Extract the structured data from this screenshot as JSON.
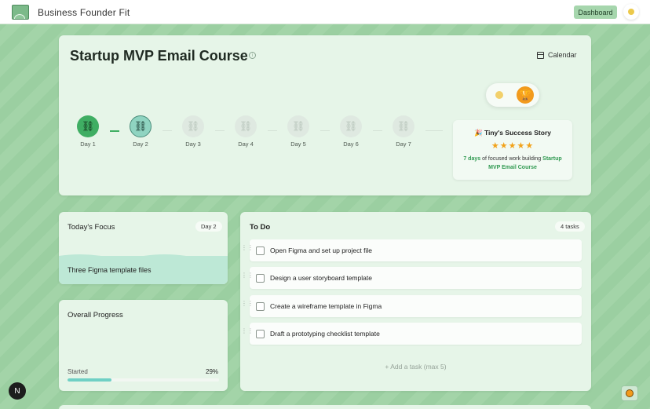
{
  "brand": {
    "name": "Business Founder Fit"
  },
  "topbar": {
    "dashboard_label": "Dashboard"
  },
  "hero": {
    "title": "Startup MVP Email Course",
    "calendar_label": "Calendar",
    "days": [
      {
        "label": "Day 1",
        "state": "done"
      },
      {
        "label": "Day 2",
        "state": "current"
      },
      {
        "label": "Day 3",
        "state": "locked"
      },
      {
        "label": "Day 4",
        "state": "locked"
      },
      {
        "label": "Day 5",
        "state": "locked"
      },
      {
        "label": "Day 6",
        "state": "locked"
      },
      {
        "label": "Day 7",
        "state": "locked"
      }
    ]
  },
  "story": {
    "title": "Tiny's Success Story",
    "stars": 5,
    "text_highlight_1": "7 days",
    "text_middle": "of focused work building",
    "text_highlight_2": "Startup MVP Email Course"
  },
  "focus": {
    "title": "Today's Focus",
    "day_badge": "Day 2",
    "item": "Three Figma template files"
  },
  "progress": {
    "title": "Overall Progress",
    "label": "Started",
    "value_text": "29%",
    "value": 29
  },
  "todo": {
    "title": "To Do",
    "count_badge": "4 tasks",
    "tasks": [
      "Open Figma and set up project file",
      "Design a user storyboard template",
      "Create a wireframe template in Figma",
      "Draft a prototyping checklist template"
    ],
    "add_label": "+ Add a task (max 5)"
  },
  "floating": {
    "n_label": "N"
  },
  "colors": {
    "accent": "#3fae63",
    "current": "#8fd4c1",
    "trophy": "#f29a1d",
    "progress_fill": "#6fd0c5"
  }
}
